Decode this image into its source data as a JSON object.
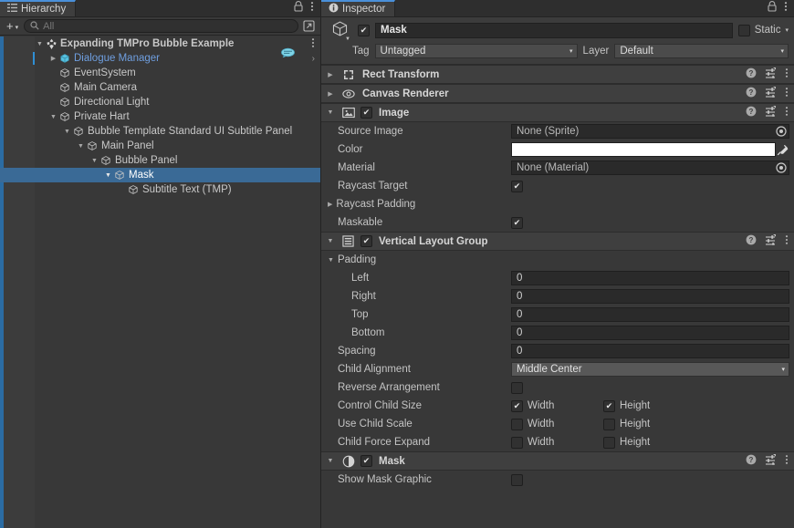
{
  "hierarchy": {
    "tab": {
      "label": "Hierarchy",
      "icon": "hierarchy-icon"
    },
    "window_icons": {
      "lock": "lock-icon",
      "menu": "kebab-menu-icon"
    },
    "toolbar": {
      "add_label": "+",
      "add_caret": "▾",
      "search_icon": "search-icon",
      "search_placeholder": "All",
      "search_value": "",
      "window_icon": "open-in-window-icon"
    },
    "items": [
      {
        "label": "Expanding TMPro Bubble Example",
        "depth": 0,
        "twisty": "▼",
        "icon": "scene-icon",
        "bold": true,
        "selected": false,
        "prefab": false,
        "kebab": "⋮"
      },
      {
        "label": "Dialogue Manager",
        "depth": 1,
        "twisty": "▶",
        "icon": "gameobject-icon",
        "bold": false,
        "selected": false,
        "prefab": true,
        "badge": "dialogue-bubble-icon",
        "chevron": "›"
      },
      {
        "label": "EventSystem",
        "depth": 1,
        "twisty": "",
        "icon": "gameobject-icon",
        "bold": false,
        "selected": false,
        "prefab": false
      },
      {
        "label": "Main Camera",
        "depth": 1,
        "twisty": "",
        "icon": "gameobject-icon",
        "bold": false,
        "selected": false,
        "prefab": false
      },
      {
        "label": "Directional Light",
        "depth": 1,
        "twisty": "",
        "icon": "gameobject-icon",
        "bold": false,
        "selected": false,
        "prefab": false
      },
      {
        "label": "Private Hart",
        "depth": 1,
        "twisty": "▼",
        "icon": "gameobject-icon",
        "bold": false,
        "selected": false,
        "prefab": false
      },
      {
        "label": "Bubble Template Standard UI Subtitle Panel",
        "depth": 2,
        "twisty": "▼",
        "icon": "gameobject-icon",
        "bold": false,
        "selected": false,
        "prefab": false
      },
      {
        "label": "Main Panel",
        "depth": 3,
        "twisty": "▼",
        "icon": "gameobject-icon",
        "bold": false,
        "selected": false,
        "prefab": false
      },
      {
        "label": "Bubble Panel",
        "depth": 4,
        "twisty": "▼",
        "icon": "gameobject-icon",
        "bold": false,
        "selected": false,
        "prefab": false
      },
      {
        "label": "Mask",
        "depth": 5,
        "twisty": "▼",
        "icon": "gameobject-icon",
        "bold": false,
        "selected": true,
        "prefab": false
      },
      {
        "label": "Subtitle Text (TMP)",
        "depth": 6,
        "twisty": "",
        "icon": "gameobject-icon",
        "bold": false,
        "selected": false,
        "prefab": false
      }
    ]
  },
  "inspector": {
    "tab": {
      "label": "Inspector",
      "icon": "info-icon"
    },
    "window_icons": {
      "lock": "lock-icon",
      "menu": "kebab-menu-icon"
    },
    "object_header": {
      "icon": "gameobject-icon",
      "enabled": true,
      "name": "Mask",
      "static_checked": false,
      "static_label": "Static",
      "static_caret": "▾",
      "tag_label": "Tag",
      "tag_value": "Untagged",
      "layer_label": "Layer",
      "layer_value": "Default",
      "caret": "▾"
    },
    "components": [
      {
        "name": "rect-transform",
        "title": "Rect Transform",
        "fold": "▶",
        "icon": "rect-transform-icon",
        "has_toggle": false,
        "help": "?",
        "preset": "preset-icon",
        "kebab": "⋮",
        "rows": []
      },
      {
        "name": "canvas-renderer",
        "title": "Canvas Renderer",
        "fold": "▶",
        "icon": "canvas-renderer-icon",
        "has_toggle": false,
        "help": "?",
        "preset": "preset-icon",
        "kebab": "⋮",
        "rows": []
      },
      {
        "name": "image",
        "title": "Image",
        "fold": "▼",
        "icon": "image-icon",
        "has_toggle": true,
        "enabled": true,
        "help": "?",
        "preset": "preset-icon",
        "kebab": "⋮",
        "rows": [
          {
            "type": "object",
            "label": "Source Image",
            "value": "None (Sprite)",
            "picker": "select-dot-icon"
          },
          {
            "type": "color",
            "label": "Color",
            "value": "#FFFFFF",
            "eyedropper": "eyedropper-icon"
          },
          {
            "type": "object",
            "label": "Material",
            "value": "None (Material)",
            "picker": "select-dot-icon"
          },
          {
            "type": "check",
            "label": "Raycast Target",
            "checked": true
          },
          {
            "type": "foldout",
            "label": "Raycast Padding",
            "arrow": "▶"
          },
          {
            "type": "check",
            "label": "Maskable",
            "checked": true
          }
        ]
      },
      {
        "name": "vertical-layout-group",
        "title": "Vertical Layout Group",
        "fold": "▼",
        "icon": "layout-group-icon",
        "has_toggle": true,
        "enabled": true,
        "help": "?",
        "preset": "preset-icon",
        "kebab": "⋮",
        "rows": [
          {
            "type": "foldout",
            "label": "Padding",
            "arrow": "▼",
            "expanded": true
          },
          {
            "type": "number",
            "label": "Left",
            "value": "0",
            "indent": true
          },
          {
            "type": "number",
            "label": "Right",
            "value": "0",
            "indent": true
          },
          {
            "type": "number",
            "label": "Top",
            "value": "0",
            "indent": true
          },
          {
            "type": "number",
            "label": "Bottom",
            "value": "0",
            "indent": true
          },
          {
            "type": "number",
            "label": "Spacing",
            "value": "0"
          },
          {
            "type": "dropdown",
            "label": "Child Alignment",
            "value": "Middle Center",
            "caret": "▾"
          },
          {
            "type": "check",
            "label": "Reverse Arrangement",
            "checked": false
          },
          {
            "type": "dual",
            "label": "Control Child Size",
            "a_label": "Width",
            "a_checked": true,
            "b_label": "Height",
            "b_checked": true
          },
          {
            "type": "dual",
            "label": "Use Child Scale",
            "a_label": "Width",
            "a_checked": false,
            "b_label": "Height",
            "b_checked": false
          },
          {
            "type": "dual",
            "label": "Child Force Expand",
            "a_label": "Width",
            "a_checked": false,
            "b_label": "Height",
            "b_checked": false
          }
        ]
      },
      {
        "name": "mask",
        "title": "Mask",
        "fold": "▼",
        "icon": "mask-icon",
        "has_toggle": true,
        "enabled": true,
        "help": "?",
        "preset": "preset-icon",
        "kebab": "⋮",
        "rows": [
          {
            "type": "check",
            "label": "Show Mask Graphic",
            "checked": false
          }
        ]
      }
    ]
  },
  "colors": {
    "panel_bg": "#383838",
    "header_bg": "#3f3f3f",
    "selection_blue": "#3a6a96",
    "prefab_blue": "#6f9fe0",
    "accent_tab": "#4a90d9",
    "field_bg": "#2a2a2a",
    "dropdown_bg": "#585858"
  }
}
